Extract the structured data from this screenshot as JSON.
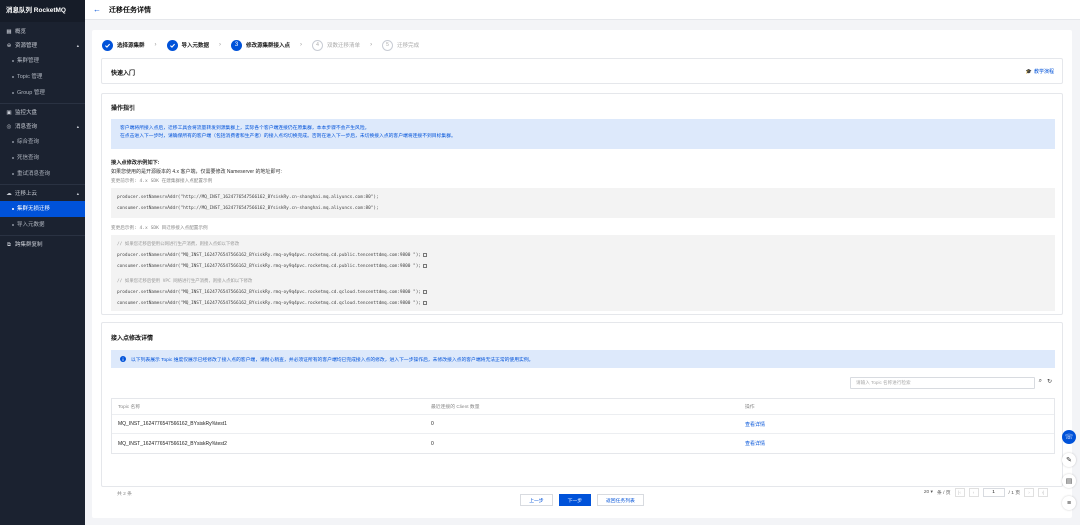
{
  "app": {
    "brand": "消息队列 RocketMQ"
  },
  "sidebar": {
    "items": [
      {
        "label": "概览",
        "icon": "grid-icon"
      },
      {
        "label": "资源管理",
        "icon": "globe-icon",
        "expanded": true
      },
      {
        "label": "集群管理"
      },
      {
        "label": "Topic 管理"
      },
      {
        "label": "Group 管理"
      },
      {
        "label": "监控大盘",
        "icon": "monitor-icon"
      },
      {
        "label": "消息查询",
        "icon": "search-icon",
        "expanded": true
      },
      {
        "label": "综合查询"
      },
      {
        "label": "死信查询"
      },
      {
        "label": "重试消息查询"
      },
      {
        "label": "迁移上云",
        "icon": "cloud-icon",
        "expanded": true
      },
      {
        "label": "集群无损迁移",
        "active": true
      },
      {
        "label": "导入元数据"
      },
      {
        "label": "跨集群复制",
        "icon": "copy-icon"
      }
    ]
  },
  "header": {
    "title": "迁移任务详情"
  },
  "steps": [
    {
      "num": "1",
      "label": "选择源集群",
      "state": "done"
    },
    {
      "num": "2",
      "label": "导入元数据",
      "state": "done"
    },
    {
      "num": "3",
      "label": "修改源集群接入点",
      "state": "current"
    },
    {
      "num": "4",
      "label": "双数迁移清单",
      "state": "todo"
    },
    {
      "num": "5",
      "label": "迁移完成",
      "state": "todo"
    }
  ],
  "quick": {
    "title": "快速入门",
    "demo_label": "教学演程"
  },
  "guide": {
    "title": "操作指引",
    "info_line1": "客户端将所接入点后，迁移工具会将流量转发到源集群上，实际各个客户端连接仍在原集群，本本步骤不会产生风险。",
    "info_line2": "在点击进入下一步时，请确保所有的客户端（包括消费者和生产者）的接入点均切换完成。否则在进入下一步后，未切换接入点的客户端将连接不到目标集群。",
    "sub_title": "接入点修改示例如下:",
    "sub_desc": "如果您使用的是开源版本的 4.x 客户端，仅需要修改 Nameserver 的地址即可:",
    "code1_label": "变更前示例: 4.x SDK 在建集群接入点配置示例",
    "code1_lines": [
      "producer.setNamesrvAddr(\"http://MQ_INST_1624776547566162_BYsiskRy.cn-shanghai.mq.aliyuncs.com:80\");",
      "consumer.setNamesrvAddr(\"http://MQ_INST_1624776547566162_BYsiskRy.cn-shanghai.mq.aliyuncs.com:80\");"
    ],
    "code2_label": "变更后示例: 4.x SDK 目迁移接入点配置示例",
    "code2_comment1": "// 如果您迁移后使用公网进行生产消费，则接入点如以下修改",
    "code2_lines1": [
      "producer.setNamesrvAddr(\"MQ_INST_1624776547566162_BYsiskRy.rmq-oy9q4pvc.rocketmq.cd.public.tencenttdmq.com:9800 \");",
      "consumer.setNamesrvAddr(\"MQ_INST_1624776547566162_BYsiskRy.rmq-oy9q4pvc.rocketmq.cd.public.tencenttdmq.com:9800 \");"
    ],
    "code2_comment2": "// 如果您迁移后使用 VPC 网络进行生产消费，则接入点如以下修改",
    "code2_lines2": [
      "producer.setNamesrvAddr(\"MQ_INST_1624776547566162_BYsiskRy.rmq-oy9q4pvc.rocketmq.cd.qcloud.tencenttdmq.com:9800 \");",
      "consumer.setNamesrvAddr(\"MQ_INST_1624776547566162_BYsiskRy.rmq-oy9q4pvc.rocketmq.cd.qcloud.tencenttdmq.com:9800 \");"
    ]
  },
  "detail": {
    "title": "接入点修改详情",
    "info": "以下列表展示 Topic 维度仅展示已经修改了接入点的客户端，请耐心稍查，并必须证所有的客户端均已完成接入点的修改，进入下一步操作后，未修改接入点的客户端将无法正常的使用实例。",
    "search_placeholder": "请输入 Topic 名称进行检索",
    "columns": [
      "Topic 名称",
      "最近连接的 Client 数量",
      "操作"
    ],
    "rows": [
      {
        "topic": "MQ_INST_1624776547566162_BYsiskRy%test1",
        "clients": "0",
        "action": "查看详情"
      },
      {
        "topic": "MQ_INST_1624776547566162_BYsiskRy%test2",
        "clients": "0",
        "action": "查看详情"
      }
    ],
    "total": "共 2 条",
    "page_size": "20 ▾",
    "page_size_unit": "条 / 页",
    "page_current": "1",
    "page_total": "/ 1 页"
  },
  "footer": {
    "prev": "上一步",
    "next": "下一步",
    "back_list": "返回任务列表"
  }
}
